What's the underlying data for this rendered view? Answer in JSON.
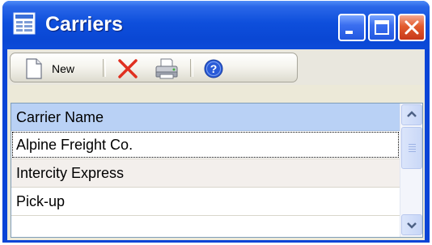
{
  "window": {
    "title": "Carriers",
    "icons": {
      "app": "form-window-icon",
      "minimize": "minimize-icon",
      "maximize": "maximize-icon",
      "close": "close-icon"
    }
  },
  "toolbar": {
    "new_label": "New",
    "icons": {
      "new": "new-document-icon",
      "delete": "delete-x-icon",
      "print": "printer-icon",
      "help": "help-question-icon"
    }
  },
  "grid": {
    "column_header": "Carrier Name",
    "rows": [
      "Alpine Freight Co.",
      "Intercity Express",
      "Pick-up"
    ],
    "selected_row": 0
  },
  "colors": {
    "title_bar": "#0a47d4",
    "close_button": "#e25b2d",
    "header_background": "#b9d1f5",
    "delete_icon": "#e03020",
    "help_icon": "#2a5bd8"
  }
}
